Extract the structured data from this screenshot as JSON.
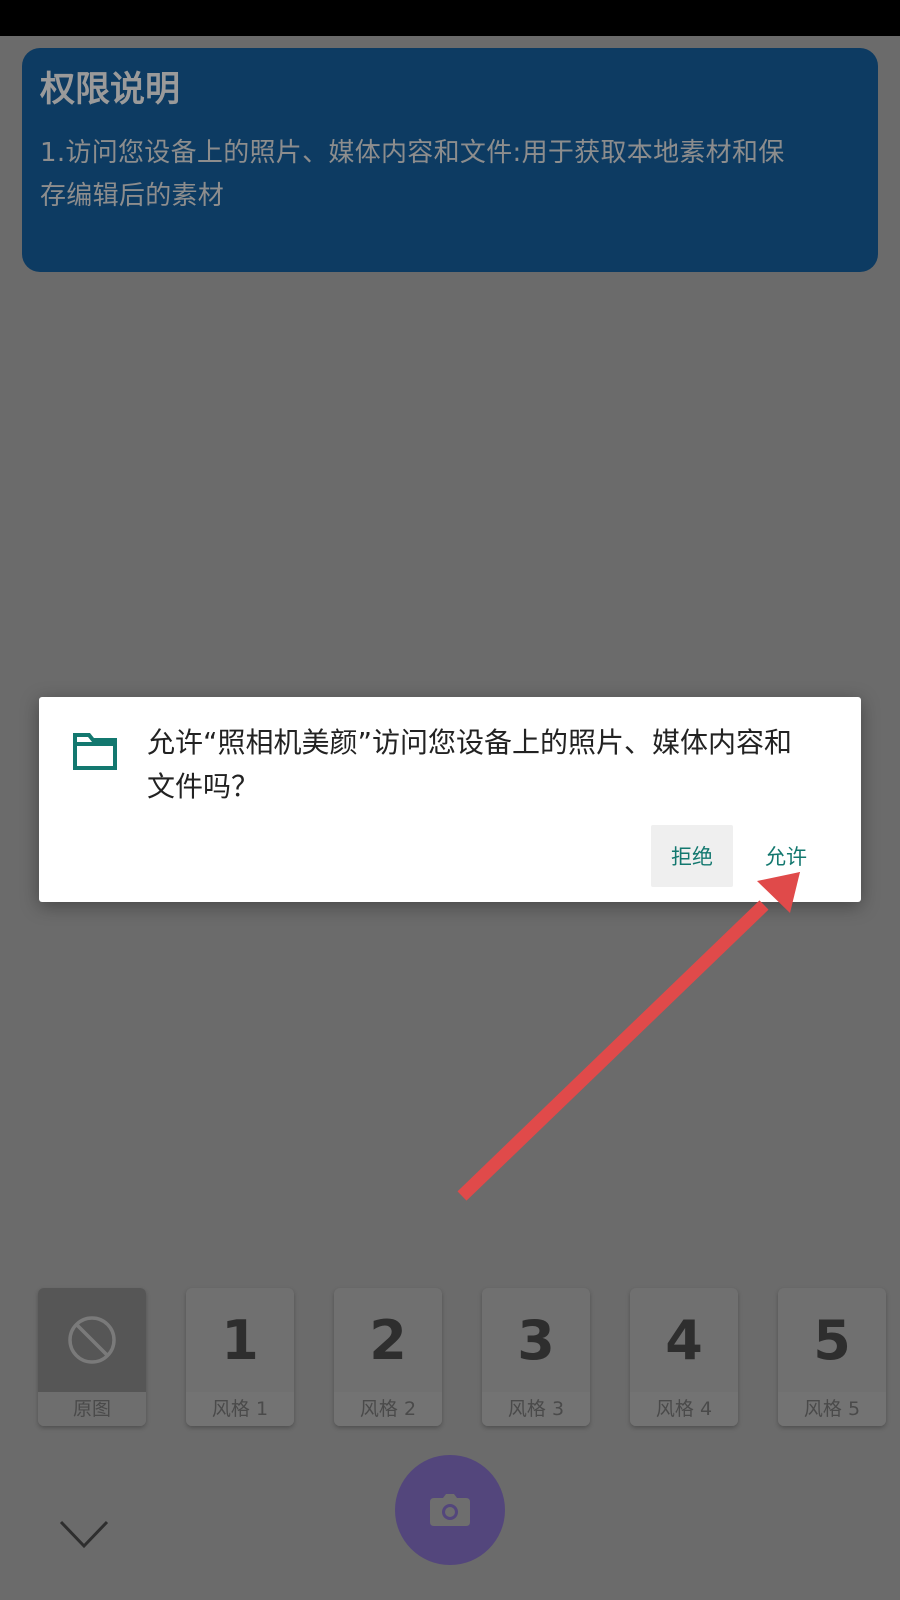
{
  "permission_card": {
    "title": "权限说明",
    "line1": "1.访问您设备上的照片、媒体内容和文件:用于获取本地素材和保",
    "line2": "存编辑后的素材",
    "background": "#0d3b62"
  },
  "dialog": {
    "icon": "folder-icon",
    "message_line1": "允许“照相机美颜”访问您设备上的照片、媒体内容和",
    "message_line2": "文件吗？",
    "deny_label": "拒绝",
    "allow_label": "允许",
    "accent": "#13786f"
  },
  "annotation": {
    "icon": "red-arrow",
    "color": "#e04a4a"
  },
  "styles": {
    "items": [
      {
        "number": "",
        "label": "原图",
        "icon": "no-filter-icon"
      },
      {
        "number": "1",
        "label": "风格 1"
      },
      {
        "number": "2",
        "label": "风格 2"
      },
      {
        "number": "3",
        "label": "风格 3"
      },
      {
        "number": "4",
        "label": "风格 4"
      },
      {
        "number": "5",
        "label": "风格 5"
      }
    ]
  },
  "bottom_bar": {
    "collapse_icon": "chevron-down-icon",
    "shutter_icon": "camera-icon",
    "shutter_color": "#53467c"
  }
}
